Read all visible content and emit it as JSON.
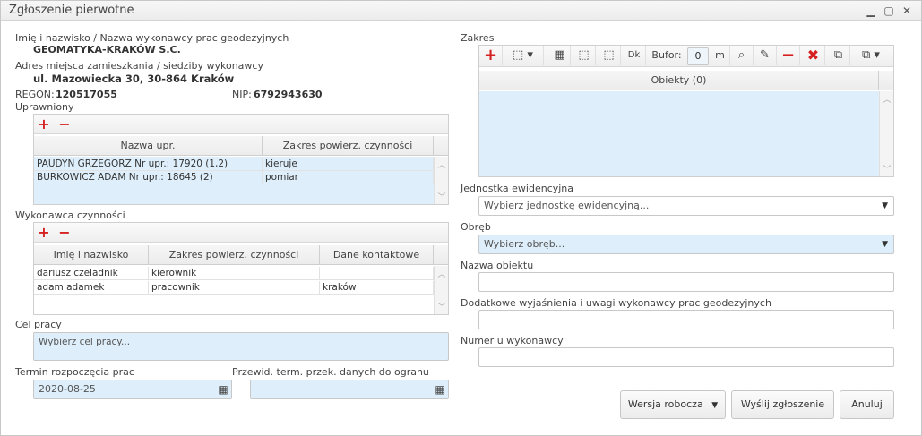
{
  "window": {
    "title": "Zgłoszenie pierwotne"
  },
  "wykonawca": {
    "name_label": "Imię i nazwisko / Nazwa wykonawcy prac geodezyjnych",
    "name_value": "GEOMATYKA-KRAKÓW S.C.",
    "address_label": "Adres miejsca zamieszkania / siedziby wykonawcy",
    "address_value": "ul. Mazowiecka 30, 30-864 Kraków",
    "regon_label": "REGON:",
    "regon_value": "120517055",
    "nip_label": "NIP:",
    "nip_value": "6792943630"
  },
  "uprawniony": {
    "label": "Uprawniony",
    "columns": [
      "Nazwa upr.",
      "Zakres powierz. czynności"
    ],
    "rows": [
      [
        "PAUDYN GRZEGORZ Nr upr.: 17920 (1,2)",
        "kieruje"
      ],
      [
        "BURKOWICZ ADAM Nr upr.: 18645 (2)",
        "pomiar"
      ]
    ]
  },
  "wykonawca_czynnosci": {
    "label": "Wykonawca czynności",
    "columns": [
      "Imię i nazwisko",
      "Zakres powierz. czynności",
      "Dane kontaktowe"
    ],
    "rows": [
      [
        "dariusz czeladnik",
        "kierownik",
        ""
      ],
      [
        "adam adamek",
        "pracownik",
        "kraków"
      ]
    ]
  },
  "cel_pracy": {
    "label": "Cel pracy",
    "placeholder": "Wybierz cel pracy..."
  },
  "termin": {
    "label": "Termin rozpoczęcia prac",
    "value": "2020-08-25"
  },
  "przewid": {
    "label": "Przewid. term. przek. danych do ogranu",
    "value": ""
  },
  "zakres": {
    "label": "Zakres",
    "bufor_label": "Bufor:",
    "bufor_value": "0",
    "bufor_unit": "m",
    "objects_header": "Obiekty (0)"
  },
  "jednostka": {
    "label": "Jednostka ewidencyjna",
    "placeholder": "Wybierz jednostkę ewidencyjną..."
  },
  "obreb": {
    "label": "Obręb",
    "placeholder": "Wybierz obręb..."
  },
  "nazwa_obiektu": {
    "label": "Nazwa obiektu",
    "value": ""
  },
  "dodatkowe": {
    "label": "Dodatkowe wyjaśnienia i uwagi wykonawcy prac geodezyjnych",
    "value": ""
  },
  "numer": {
    "label": "Numer u wykonawcy",
    "value": ""
  },
  "buttons": {
    "wersja": "Wersja robocza",
    "wyslij": "Wyślij zgłoszenie",
    "anuluj": "Anuluj"
  }
}
